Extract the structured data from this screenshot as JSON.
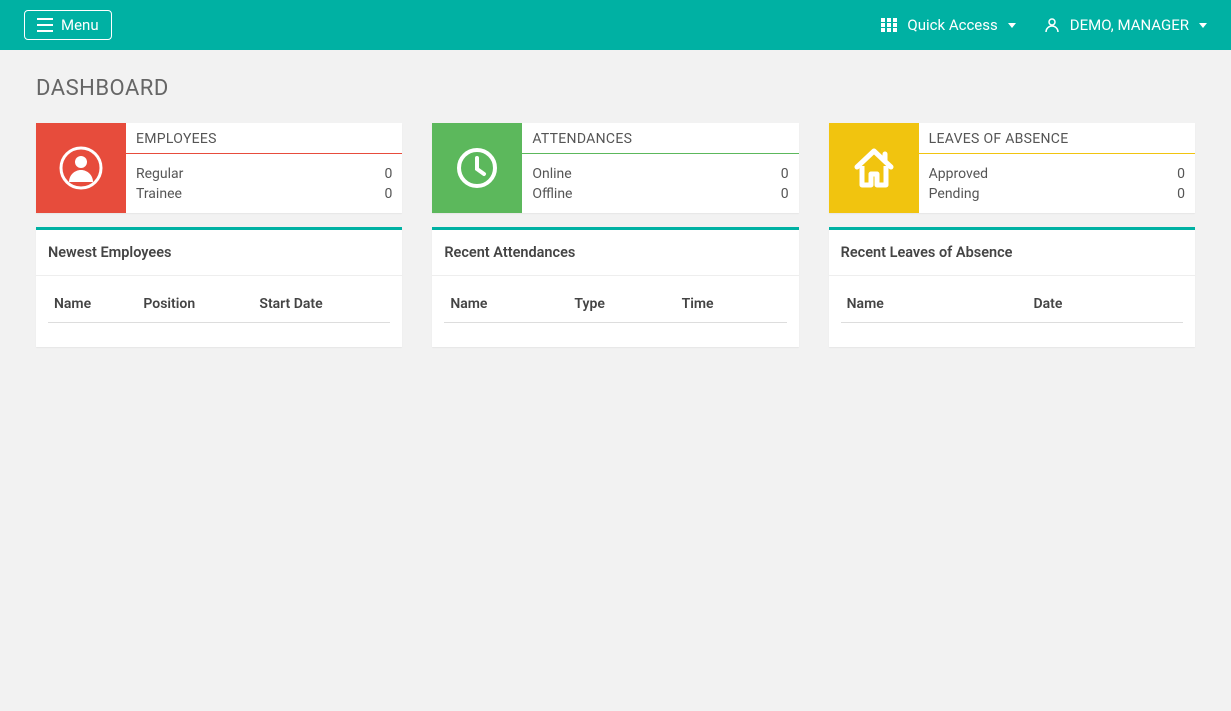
{
  "topbar": {
    "menu_label": "Menu",
    "quick_access_label": "Quick Access",
    "user_name": "DEMO, MANAGER"
  },
  "page_title": "DASHBOARD",
  "cards": {
    "employees": {
      "title": "EMPLOYEES",
      "rows": [
        {
          "label": "Regular",
          "value": "0"
        },
        {
          "label": "Trainee",
          "value": "0"
        }
      ]
    },
    "attendances": {
      "title": "ATTENDANCES",
      "rows": [
        {
          "label": "Online",
          "value": "0"
        },
        {
          "label": "Offline",
          "value": "0"
        }
      ]
    },
    "leaves": {
      "title": "LEAVES OF ABSENCE",
      "rows": [
        {
          "label": "Approved",
          "value": "0"
        },
        {
          "label": "Pending",
          "value": "0"
        }
      ]
    }
  },
  "panels": {
    "newest_employees": {
      "title": "Newest Employees",
      "columns": [
        "Name",
        "Position",
        "Start Date"
      ]
    },
    "recent_attendances": {
      "title": "Recent Attendances",
      "columns": [
        "Name",
        "Type",
        "Time"
      ]
    },
    "recent_leaves": {
      "title": "Recent Leaves of Absence",
      "columns": [
        "Name",
        "Date"
      ]
    }
  }
}
